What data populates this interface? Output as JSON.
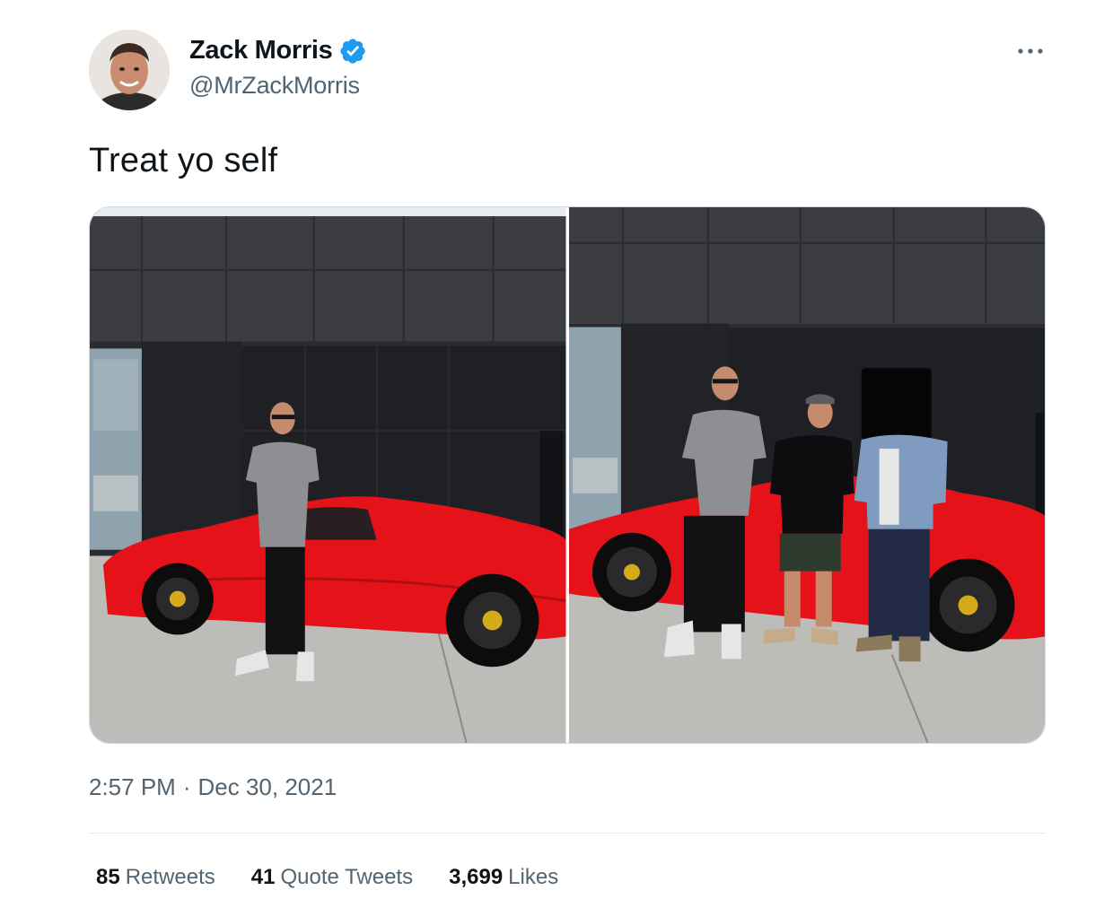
{
  "author": {
    "display_name": "Zack Morris",
    "handle": "@MrZackMorris",
    "verified": true,
    "verified_color": "#1d9bf0"
  },
  "tweet": {
    "text": "Treat yo self",
    "time": "2:57 PM",
    "separator": "·",
    "date": "Dec 30, 2021"
  },
  "media": {
    "photo_count": 2
  },
  "stats": [
    {
      "count": "85",
      "label": "Retweets"
    },
    {
      "count": "41",
      "label": "Quote Tweets"
    },
    {
      "count": "3,699",
      "label": "Likes"
    }
  ],
  "icons": {
    "verified": "verified-badge-icon",
    "more": "more-horizontal-icon"
  },
  "colors": {
    "text_primary": "#0f1419",
    "text_secondary": "#536471",
    "border": "#cfd9de",
    "car_red": "#e5121a"
  }
}
